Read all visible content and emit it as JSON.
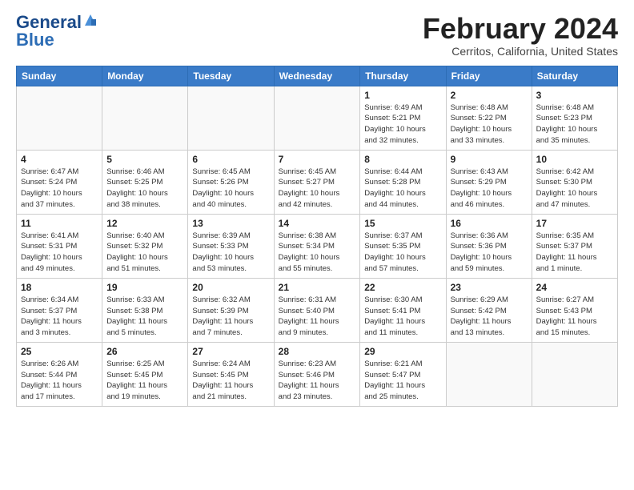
{
  "header": {
    "logo_line1": "General",
    "logo_line2": "Blue",
    "title": "February 2024",
    "location": "Cerritos, California, United States"
  },
  "days_of_week": [
    "Sunday",
    "Monday",
    "Tuesday",
    "Wednesday",
    "Thursday",
    "Friday",
    "Saturday"
  ],
  "weeks": [
    [
      {
        "num": "",
        "info": ""
      },
      {
        "num": "",
        "info": ""
      },
      {
        "num": "",
        "info": ""
      },
      {
        "num": "",
        "info": ""
      },
      {
        "num": "1",
        "info": "Sunrise: 6:49 AM\nSunset: 5:21 PM\nDaylight: 10 hours\nand 32 minutes."
      },
      {
        "num": "2",
        "info": "Sunrise: 6:48 AM\nSunset: 5:22 PM\nDaylight: 10 hours\nand 33 minutes."
      },
      {
        "num": "3",
        "info": "Sunrise: 6:48 AM\nSunset: 5:23 PM\nDaylight: 10 hours\nand 35 minutes."
      }
    ],
    [
      {
        "num": "4",
        "info": "Sunrise: 6:47 AM\nSunset: 5:24 PM\nDaylight: 10 hours\nand 37 minutes."
      },
      {
        "num": "5",
        "info": "Sunrise: 6:46 AM\nSunset: 5:25 PM\nDaylight: 10 hours\nand 38 minutes."
      },
      {
        "num": "6",
        "info": "Sunrise: 6:45 AM\nSunset: 5:26 PM\nDaylight: 10 hours\nand 40 minutes."
      },
      {
        "num": "7",
        "info": "Sunrise: 6:45 AM\nSunset: 5:27 PM\nDaylight: 10 hours\nand 42 minutes."
      },
      {
        "num": "8",
        "info": "Sunrise: 6:44 AM\nSunset: 5:28 PM\nDaylight: 10 hours\nand 44 minutes."
      },
      {
        "num": "9",
        "info": "Sunrise: 6:43 AM\nSunset: 5:29 PM\nDaylight: 10 hours\nand 46 minutes."
      },
      {
        "num": "10",
        "info": "Sunrise: 6:42 AM\nSunset: 5:30 PM\nDaylight: 10 hours\nand 47 minutes."
      }
    ],
    [
      {
        "num": "11",
        "info": "Sunrise: 6:41 AM\nSunset: 5:31 PM\nDaylight: 10 hours\nand 49 minutes."
      },
      {
        "num": "12",
        "info": "Sunrise: 6:40 AM\nSunset: 5:32 PM\nDaylight: 10 hours\nand 51 minutes."
      },
      {
        "num": "13",
        "info": "Sunrise: 6:39 AM\nSunset: 5:33 PM\nDaylight: 10 hours\nand 53 minutes."
      },
      {
        "num": "14",
        "info": "Sunrise: 6:38 AM\nSunset: 5:34 PM\nDaylight: 10 hours\nand 55 minutes."
      },
      {
        "num": "15",
        "info": "Sunrise: 6:37 AM\nSunset: 5:35 PM\nDaylight: 10 hours\nand 57 minutes."
      },
      {
        "num": "16",
        "info": "Sunrise: 6:36 AM\nSunset: 5:36 PM\nDaylight: 10 hours\nand 59 minutes."
      },
      {
        "num": "17",
        "info": "Sunrise: 6:35 AM\nSunset: 5:37 PM\nDaylight: 11 hours\nand 1 minute."
      }
    ],
    [
      {
        "num": "18",
        "info": "Sunrise: 6:34 AM\nSunset: 5:37 PM\nDaylight: 11 hours\nand 3 minutes."
      },
      {
        "num": "19",
        "info": "Sunrise: 6:33 AM\nSunset: 5:38 PM\nDaylight: 11 hours\nand 5 minutes."
      },
      {
        "num": "20",
        "info": "Sunrise: 6:32 AM\nSunset: 5:39 PM\nDaylight: 11 hours\nand 7 minutes."
      },
      {
        "num": "21",
        "info": "Sunrise: 6:31 AM\nSunset: 5:40 PM\nDaylight: 11 hours\nand 9 minutes."
      },
      {
        "num": "22",
        "info": "Sunrise: 6:30 AM\nSunset: 5:41 PM\nDaylight: 11 hours\nand 11 minutes."
      },
      {
        "num": "23",
        "info": "Sunrise: 6:29 AM\nSunset: 5:42 PM\nDaylight: 11 hours\nand 13 minutes."
      },
      {
        "num": "24",
        "info": "Sunrise: 6:27 AM\nSunset: 5:43 PM\nDaylight: 11 hours\nand 15 minutes."
      }
    ],
    [
      {
        "num": "25",
        "info": "Sunrise: 6:26 AM\nSunset: 5:44 PM\nDaylight: 11 hours\nand 17 minutes."
      },
      {
        "num": "26",
        "info": "Sunrise: 6:25 AM\nSunset: 5:45 PM\nDaylight: 11 hours\nand 19 minutes."
      },
      {
        "num": "27",
        "info": "Sunrise: 6:24 AM\nSunset: 5:45 PM\nDaylight: 11 hours\nand 21 minutes."
      },
      {
        "num": "28",
        "info": "Sunrise: 6:23 AM\nSunset: 5:46 PM\nDaylight: 11 hours\nand 23 minutes."
      },
      {
        "num": "29",
        "info": "Sunrise: 6:21 AM\nSunset: 5:47 PM\nDaylight: 11 hours\nand 25 minutes."
      },
      {
        "num": "",
        "info": ""
      },
      {
        "num": "",
        "info": ""
      }
    ]
  ]
}
